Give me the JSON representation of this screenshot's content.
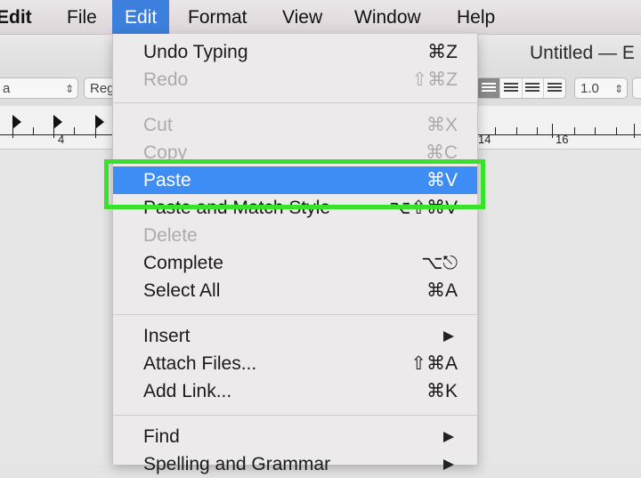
{
  "menubar": {
    "items": [
      {
        "label": "Edit"
      },
      {
        "label": "File"
      },
      {
        "label": "Edit"
      },
      {
        "label": "Format"
      },
      {
        "label": "View"
      },
      {
        "label": "Window"
      },
      {
        "label": "Help"
      }
    ]
  },
  "window": {
    "title": "Untitled — E",
    "toolbar": {
      "font_value": "a",
      "style_value": "Reg",
      "line_spacing": "1.0"
    },
    "ruler": {
      "numbers": [
        "4",
        "14",
        "16"
      ]
    }
  },
  "menu": {
    "items": [
      {
        "label": "Undo Typing",
        "shortcut": "⌘Z"
      },
      {
        "label": "Redo",
        "shortcut": "⇧⌘Z"
      },
      {
        "label": "Cut",
        "shortcut": "⌘X"
      },
      {
        "label": "Copy",
        "shortcut": "⌘C"
      },
      {
        "label": "Paste",
        "shortcut": "⌘V"
      },
      {
        "label": "Paste and Match Style",
        "shortcut": "⌥⇧⌘V"
      },
      {
        "label": "Delete",
        "shortcut": ""
      },
      {
        "label": "Complete",
        "shortcut": "⌥⎋"
      },
      {
        "label": "Select All",
        "shortcut": "⌘A"
      },
      {
        "label": "Insert",
        "shortcut": ""
      },
      {
        "label": "Attach Files...",
        "shortcut": "⇧⌘A"
      },
      {
        "label": "Add Link...",
        "shortcut": "⌘K"
      },
      {
        "label": "Find",
        "shortcut": ""
      },
      {
        "label": "Spelling and Grammar",
        "shortcut": ""
      }
    ]
  },
  "colors": {
    "selection": "#3e8df4",
    "highlight_box": "#39e22a",
    "active_menu": "#3d7fdc"
  }
}
